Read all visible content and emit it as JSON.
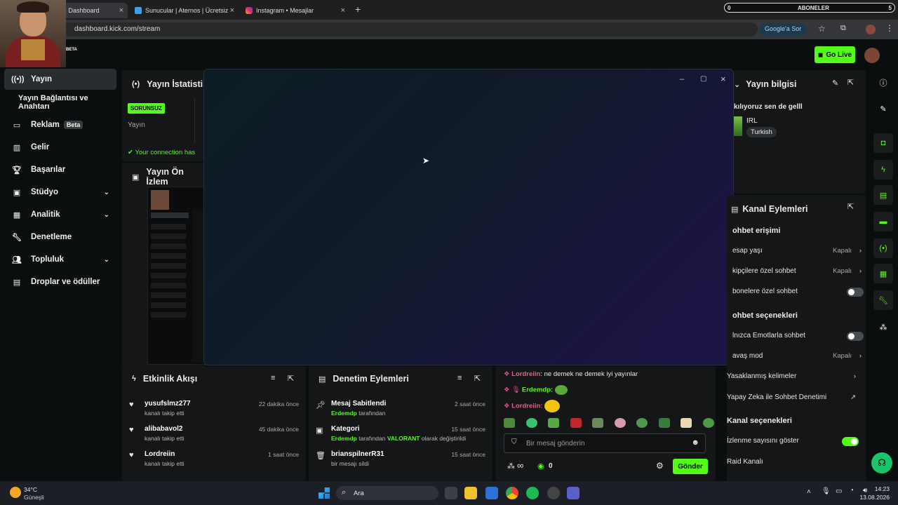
{
  "browser": {
    "tabs": [
      {
        "label": "‹ Dashboard"
      },
      {
        "label": "Sunucular | Aternos | Ücretsiz M"
      },
      {
        "label": "Instagram • Mesajlar"
      }
    ],
    "new_tab": "+",
    "url": "dashboard.kick.com/stream",
    "google_btn": "Google'a Sor"
  },
  "sub_overlay": {
    "left": "0",
    "title": "ABONELER",
    "right": "5"
  },
  "header": {
    "beta": "BETA",
    "go_live": "Go Live"
  },
  "sidebar": {
    "items": [
      {
        "label": "Yayın"
      },
      {
        "label": "Yayın Bağlantısı ve Anahtarı"
      },
      {
        "label": "Reklam",
        "badge": "Beta"
      },
      {
        "label": "Gelir"
      },
      {
        "label": "Başarılar"
      },
      {
        "label": "Stüdyo"
      },
      {
        "label": "Analitik"
      },
      {
        "label": "Denetleme"
      },
      {
        "label": "Topluluk"
      },
      {
        "label": "Droplar ve ödüller"
      }
    ]
  },
  "stats": {
    "title": "Yayın İstatisti",
    "badge": "SORUNSUZ",
    "label": "Yayın",
    "conn": "Your connection has"
  },
  "preview": {
    "title": "Yayın Ön İzlem"
  },
  "stream_info": {
    "title": "Yayın bilgisi",
    "stream_title": "kılıyoruz sen de gelll",
    "category": "IRL",
    "language": "Turkish"
  },
  "channel_actions": {
    "title": "Kanal Eylemleri",
    "chat_access": "ohbet erişimi",
    "rows": [
      {
        "label": "esap yaşı",
        "value": "Kapalı"
      },
      {
        "label": "kipçilere özel sohbet",
        "value": "Kapalı"
      },
      {
        "label": "bonelere özel sohbet"
      }
    ],
    "chat_options": "ohbet seçenekleri",
    "rows2": [
      {
        "label": "lnızca Emotlarla sohbet"
      },
      {
        "label": "avaş mod",
        "value": "Kapalı"
      },
      {
        "label": "Yasaklanmış kelimeler"
      },
      {
        "label": "Yapay Zeka ile Sohbet Denetimi"
      }
    ],
    "channel_options": "Kanal seçenekleri",
    "rows3": [
      {
        "label": "İzlenme sayısını göster"
      },
      {
        "label": "Raid Kanalı"
      }
    ]
  },
  "activity": {
    "title": "Etkinlik Akışı",
    "items": [
      {
        "user": "yusufslmz277",
        "action": "kanalı takip etti",
        "time": "22 dakika önce"
      },
      {
        "user": "alibabavol2",
        "action": "kanalı takip etti",
        "time": "45 dakika önce"
      },
      {
        "user": "Lordreiin",
        "action": "kanalı takip etti",
        "time": "1 saat önce"
      }
    ]
  },
  "moderation": {
    "title": "Denetim Eylemleri",
    "items": [
      {
        "title": "Mesaj Sabitlendi",
        "user": "Erdemdp",
        "rest": " tarafından",
        "time": "2 saat önce"
      },
      {
        "title": "Kategori",
        "user": "Erdemdp",
        "mid": " tarafından ",
        "cat": "VALORANT",
        "rest": " olarak değiştirildi",
        "time": "15 saat önce"
      },
      {
        "title": "brianspilnerR31",
        "plain": "bir mesajı sildi",
        "time": "15 saat önce"
      }
    ]
  },
  "chat": {
    "messages": [
      {
        "user": "Lordreiin",
        "text": "ne demek ne demek iyi yayınlar"
      },
      {
        "user": "Erdemdp:"
      },
      {
        "user": "Lordreiin:"
      }
    ],
    "placeholder": "Bir mesaj gönderin",
    "infinity": "∞",
    "kick_count": "0",
    "send": "Gönder"
  },
  "taskbar": {
    "temp": "34°C",
    "weather": "Güneşli",
    "search": "Ara",
    "time": "14:23",
    "date": "13.08.2026"
  },
  "colors": {
    "accent": "#53fc18",
    "bg": "#0b0e0f",
    "panel": "#141617"
  }
}
